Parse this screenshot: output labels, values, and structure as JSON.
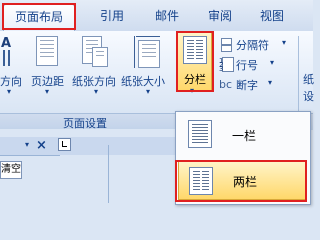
{
  "tabs": [
    {
      "label": "页面布局",
      "active": true
    },
    {
      "label": "引用"
    },
    {
      "label": "邮件"
    },
    {
      "label": "审阅"
    },
    {
      "label": "视图"
    }
  ],
  "ribbon": {
    "buttons": {
      "direction": "方向",
      "margins": "页边距",
      "orientation": "纸张方向",
      "size": "纸张大小",
      "columns": "分栏"
    },
    "small": {
      "breaks": "分隔符",
      "line_numbers": "行号",
      "hyphenation": "断字"
    },
    "partial_right": [
      "纸",
      "设"
    ],
    "group_label": "页面设置"
  },
  "columns_menu": [
    {
      "label": "一栏",
      "selected": false
    },
    {
      "label": "两栏",
      "selected": true
    }
  ],
  "lower": {
    "partial_text": "清空",
    "close_glyph": "×"
  },
  "colors": {
    "highlight_box": "#e02020",
    "selected_item": "#ffd86a"
  }
}
